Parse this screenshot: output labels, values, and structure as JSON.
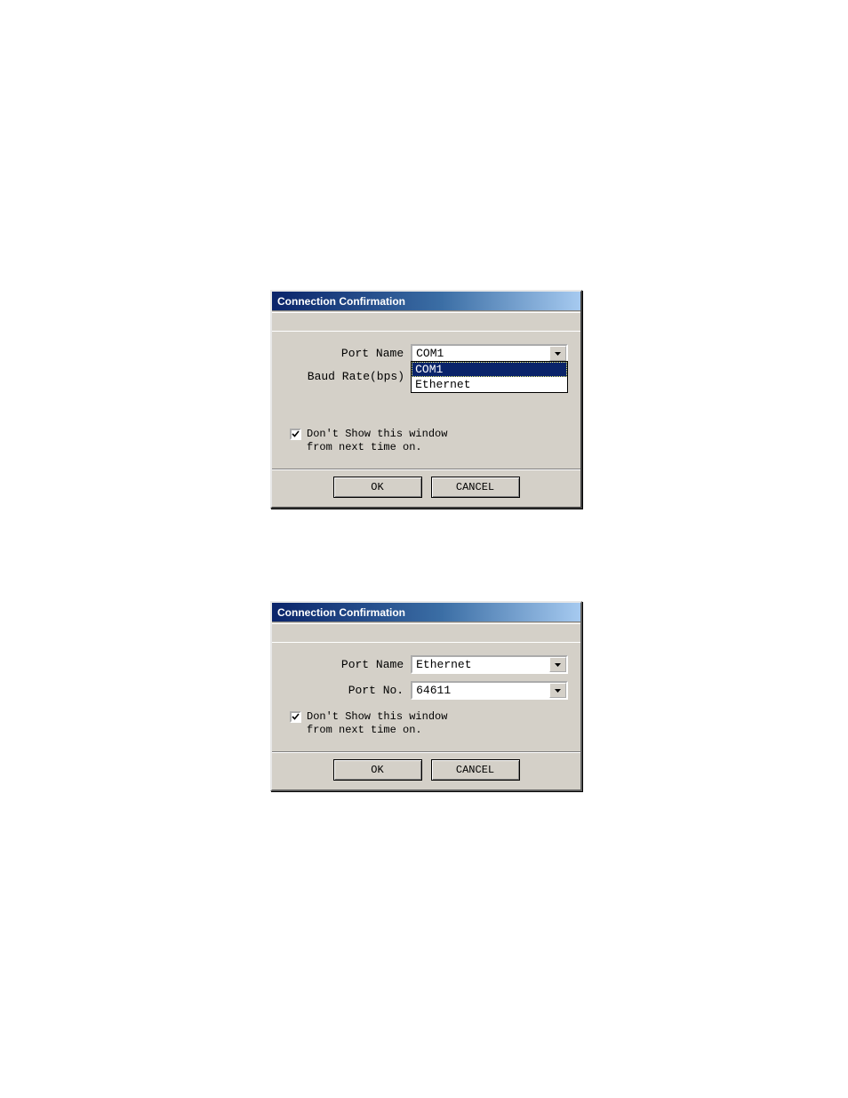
{
  "dialog1": {
    "title": "Connection Confirmation",
    "port_name_label": "Port Name",
    "baud_rate_label": "Baud Rate(bps)",
    "port_name_value": "COM1",
    "dropdown_options": [
      "COM1",
      "Ethernet"
    ],
    "checkbox_line1": "Don't Show this window",
    "checkbox_line2": "from next time on.",
    "checkbox_checked": true,
    "ok_label": "OK",
    "cancel_label": "CANCEL"
  },
  "dialog2": {
    "title": "Connection Confirmation",
    "port_name_label": "Port Name",
    "port_no_label": "Port No.",
    "port_name_value": "Ethernet",
    "port_no_value": "64611",
    "checkbox_line1": "Don't Show this window",
    "checkbox_line2": "from next time on.",
    "checkbox_checked": true,
    "ok_label": "OK",
    "cancel_label": "CANCEL"
  }
}
